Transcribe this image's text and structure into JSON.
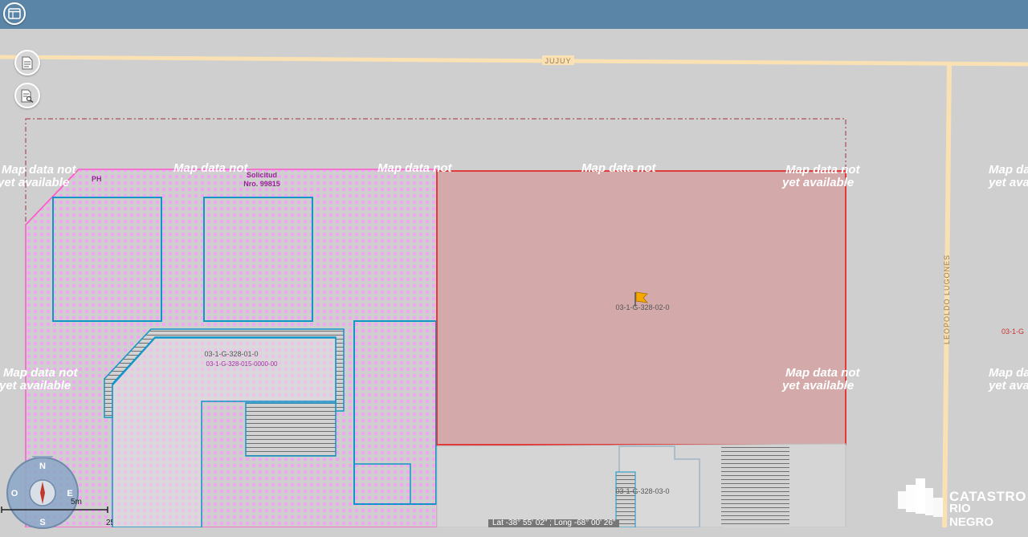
{
  "map": {
    "streets": {
      "top": "JUJUY",
      "right": "LEOPOLDO LUGONES"
    },
    "no_data": {
      "line1": "Map data not",
      "line2": "yet available"
    },
    "parcels": {
      "ph_label": "PH",
      "solicitud_line1": "Solicitud",
      "solicitud_line2": "Nro. 99815",
      "p01": "03-1-G-328-01-0",
      "p01_sub": "03-1-G-328-015-0000-00",
      "p02": "03-1-G-328-02-0",
      "p03": "03-1-G-328-03-0",
      "p_right": "03-1-G"
    },
    "scale": {
      "metric": "5m",
      "imperial": "25ft"
    },
    "compass": {
      "n": "N",
      "s": "S",
      "e": "E",
      "w": "O"
    },
    "coordinates": "Lat -38° 55' 02\" ; Long -68° 00' 26\""
  },
  "logo": {
    "line1": "CATASTRO",
    "line2": "RIO NEGRO"
  },
  "icons": {
    "window": "window-icon",
    "doc": "document-icon",
    "search_doc": "document-search-icon"
  },
  "colors": {
    "topbar": "#5b85a6",
    "selected_fill": "#d3a9a9",
    "selected_stroke": "#e03a3a",
    "building_stroke": "#1196c8",
    "ph_stroke": "#ff59c8"
  }
}
